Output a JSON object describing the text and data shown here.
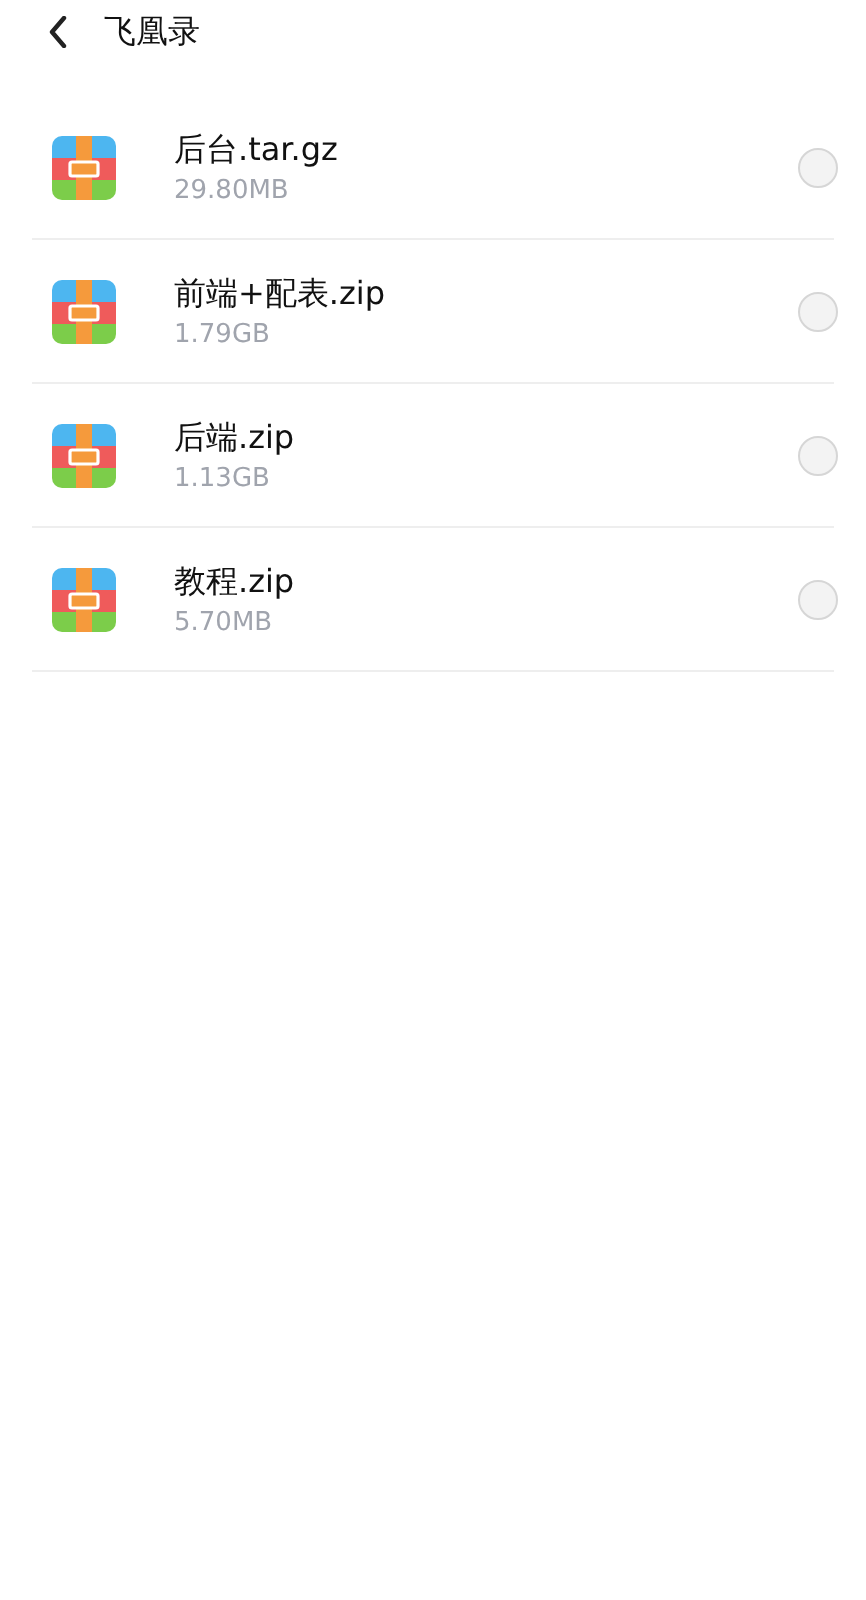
{
  "header": {
    "title": "飞凰录"
  },
  "files": [
    {
      "name": "后台.tar.gz",
      "size": "29.80MB",
      "selected": false
    },
    {
      "name": "前端+配表.zip",
      "size": "1.79GB",
      "selected": false
    },
    {
      "name": "后端.zip",
      "size": "1.13GB",
      "selected": false
    },
    {
      "name": "教程.zip",
      "size": "5.70MB",
      "selected": false
    }
  ]
}
